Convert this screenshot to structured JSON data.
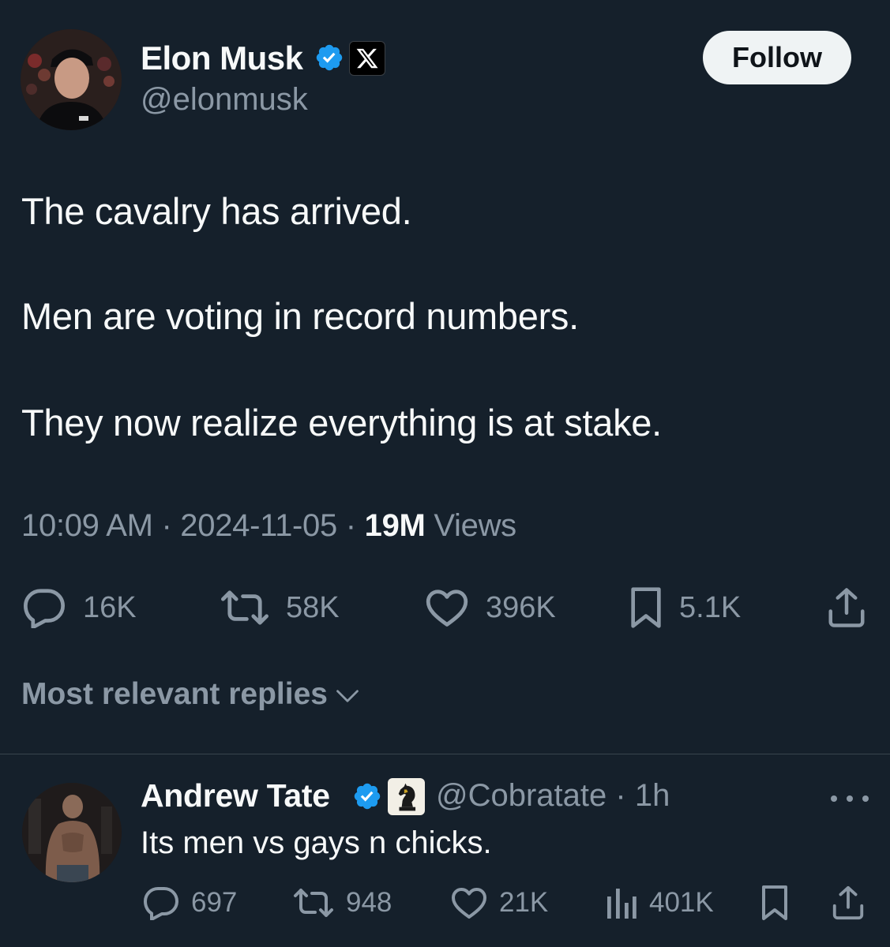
{
  "tweet": {
    "author": {
      "name": "Elon Musk",
      "handle": "@elonmusk",
      "verified": true,
      "affiliation_badge": "x-logo-icon"
    },
    "follow_label": "Follow",
    "text_lines": [
      "The cavalry has arrived.",
      "Men are voting in record numbers.",
      "They now realize everything is at stake."
    ],
    "meta": {
      "time": "10:09 AM",
      "separator": "·",
      "date": "2024-11-05",
      "views_count": "19M",
      "views_label": "Views"
    },
    "stats": {
      "replies": "16K",
      "reposts": "58K",
      "likes": "396K",
      "bookmarks": "5.1K"
    }
  },
  "replies_sort_label": "Most relevant replies",
  "reply": {
    "author": {
      "name": "Andrew Tate",
      "handle": "@Cobratate",
      "verified": true,
      "affiliation_badge": "chess-knight-icon"
    },
    "time": "1h",
    "handle_time": "@Cobratate · 1h",
    "text": "Its men vs gays n chicks.",
    "stats": {
      "replies": "697",
      "reposts": "948",
      "likes": "21K",
      "views": "401K"
    }
  },
  "colors": {
    "background": "#15202b",
    "text_primary": "#f7f9f9",
    "text_secondary": "#8b98a5",
    "verified_blue": "#1d9bf0",
    "divider": "#38444d",
    "follow_button_bg": "#eff3f4"
  }
}
